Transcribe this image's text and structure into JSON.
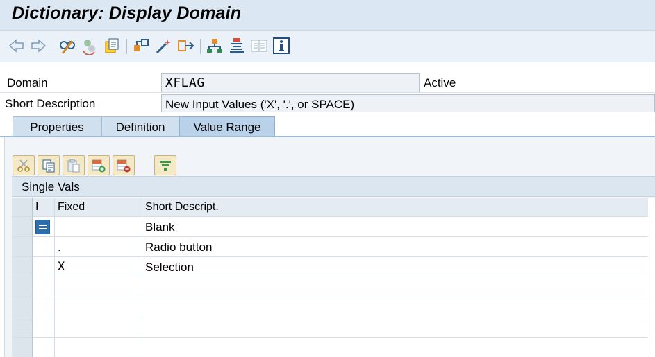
{
  "window": {
    "title": "Dictionary: Display Domain"
  },
  "toolbar": {
    "icons": [
      "back-arrow-icon",
      "forward-arrow-icon",
      "edit-display-icon",
      "other-object-icon",
      "active-inactive-icon",
      "where-used-icon",
      "display-object-list-icon",
      "check-icon",
      "activate-icon",
      "navigate-icon",
      "hierarchy-icon",
      "structure-icon",
      "documentation-icon",
      "information-icon"
    ]
  },
  "domain": {
    "label": "Domain",
    "value": "XFLAG",
    "status": "Active"
  },
  "short_description": {
    "label": "Short Description",
    "value": "New Input Values ('X', '.', or SPACE)"
  },
  "tabs": [
    {
      "label": "Properties",
      "active": false
    },
    {
      "label": "Definition",
      "active": false
    },
    {
      "label": "Value Range",
      "active": true
    }
  ],
  "grid_toolbar": {
    "icons": [
      "cut-icon",
      "copy-icon",
      "paste-icon",
      "insert-row-icon",
      "delete-row-icon",
      "filter-icon"
    ]
  },
  "single_vals": {
    "title": "Single Vals",
    "columns": {
      "indicator": "I",
      "fixed": "Fixed",
      "description": "Short Descript."
    },
    "rows": [
      {
        "fixed": "",
        "description": "Blank"
      },
      {
        "fixed": ".",
        "description": "Radio button"
      },
      {
        "fixed": "X",
        "description": "Selection"
      },
      {
        "fixed": "",
        "description": ""
      },
      {
        "fixed": "",
        "description": ""
      },
      {
        "fixed": "",
        "description": ""
      },
      {
        "fixed": "",
        "description": ""
      }
    ]
  },
  "colors": {
    "title_bar": "#dbe8f3",
    "toolbar": "#eaf1f8",
    "accent_blue": "#2b6fb2",
    "active_tab": "#b9d2ea"
  }
}
